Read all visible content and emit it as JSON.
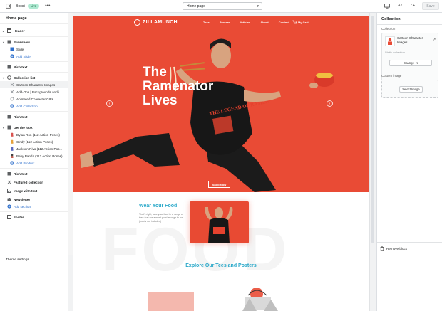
{
  "topbar": {
    "theme_name": "Boost",
    "live_badge": "Live",
    "more_label": "•••",
    "page_select": "Home page",
    "save_label": "Save"
  },
  "sidebar": {
    "title": "Home page",
    "items": [
      {
        "label": "Header",
        "type": "section"
      },
      {
        "label": "Slideshow",
        "type": "section"
      },
      {
        "label": "Slide",
        "type": "child"
      },
      {
        "label": "Add Slide",
        "type": "add"
      },
      {
        "label": "Rich text",
        "type": "section"
      },
      {
        "label": "Collection list",
        "type": "section"
      },
      {
        "label": "Cartoon Character Images",
        "type": "child"
      },
      {
        "label": "Add-Ons | Backgrounds and i...",
        "type": "child"
      },
      {
        "label": "Animated Character GIFs",
        "type": "child"
      },
      {
        "label": "Add Collection",
        "type": "add"
      },
      {
        "label": "Rich text",
        "type": "section"
      },
      {
        "label": "Get the look",
        "type": "section"
      },
      {
        "label": "Dylan Ron (112 Action Poses)",
        "type": "child"
      },
      {
        "label": "Cindy (112 Action Poses)",
        "type": "child"
      },
      {
        "label": "Jackson Rivo (112 Action Pos...",
        "type": "child"
      },
      {
        "label": "Baby Panda (112 Action Poses)",
        "type": "child"
      },
      {
        "label": "Add Product",
        "type": "add"
      },
      {
        "label": "Rich text",
        "type": "section"
      },
      {
        "label": "Featured collection",
        "type": "section"
      },
      {
        "label": "Image with text",
        "type": "section"
      },
      {
        "label": "Newsletter",
        "type": "section"
      },
      {
        "label": "Add section",
        "type": "add"
      },
      {
        "label": "Footer",
        "type": "section"
      }
    ],
    "theme_settings": "Theme settings"
  },
  "preview": {
    "brand": "ZILLAMUNCH",
    "nav": [
      "Tees",
      "Posters",
      "Articles",
      "About",
      "Contact"
    ],
    "cart": "My Cart",
    "hero_title": "The Ramenator Lives",
    "shop_now": "Shop Now",
    "wear_title": "Wear Your Food",
    "wear_text": "That's right, take your food in a range of tees that are almost good enough to eat (bowls not included)",
    "food_bg": "FOOD",
    "explore_title": "Explore Our Tees and Posters",
    "shirt_text": "THE LEGEND OF RAMEN"
  },
  "right_panel": {
    "title": "Collection",
    "collection_label": "Collection",
    "collection_name": "Cartoon Character Images",
    "collection_sub": "Static collection",
    "change_label": "Change",
    "custom_image_label": "Custom image",
    "select_image_label": "Select Image",
    "remove_block_label": "Remove block"
  },
  "colors": {
    "hero_red": "#e94b35",
    "accent_teal": "#29a8c9",
    "live_green": "#aee9d1",
    "link_blue": "#2c6ecb"
  }
}
